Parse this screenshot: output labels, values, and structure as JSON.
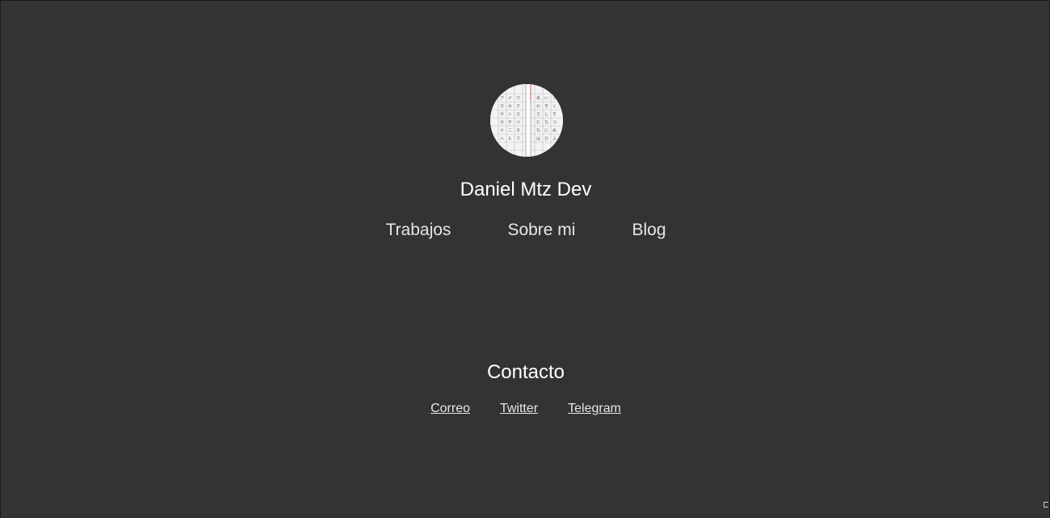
{
  "profile": {
    "name": "Daniel Mtz Dev",
    "avatar_icon": "avatar-photo"
  },
  "nav": {
    "items": [
      {
        "label": "Trabajos"
      },
      {
        "label": "Sobre mi"
      },
      {
        "label": "Blog"
      }
    ]
  },
  "contact": {
    "title": "Contacto",
    "links": [
      {
        "label": "Correo"
      },
      {
        "label": "Twitter"
      },
      {
        "label": "Telegram"
      }
    ]
  },
  "colors": {
    "background": "#333333",
    "text": "#ffffff",
    "link": "#e6e6e6"
  }
}
